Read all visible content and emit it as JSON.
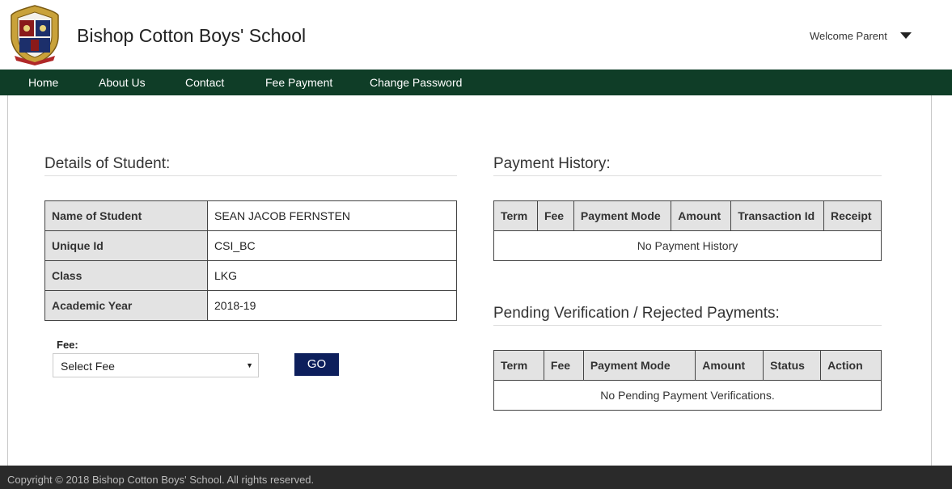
{
  "header": {
    "school_name": "Bishop Cotton Boys' School",
    "welcome": "Welcome Parent"
  },
  "nav": {
    "items": [
      "Home",
      "About Us",
      "Contact",
      "Fee Payment",
      "Change Password"
    ]
  },
  "student": {
    "title": "Details of Student:",
    "rows": [
      {
        "label": "Name of Student",
        "value": "SEAN JACOB FERNSTEN"
      },
      {
        "label": "Unique Id",
        "value": "CSI_BC"
      },
      {
        "label": "Class",
        "value": "LKG"
      },
      {
        "label": "Academic Year",
        "value": "2018-19"
      }
    ]
  },
  "fee_form": {
    "label": "Fee:",
    "selected": "Select Fee",
    "go_label": "GO"
  },
  "payment_history": {
    "title": "Payment History:",
    "columns": [
      "Term",
      "Fee",
      "Payment Mode",
      "Amount",
      "Transaction Id",
      "Receipt"
    ],
    "empty_message": "No Payment History"
  },
  "pending": {
    "title": "Pending Verification / Rejected Payments:",
    "columns": [
      "Term",
      "Fee",
      "Payment Mode",
      "Amount",
      "Status",
      "Action"
    ],
    "empty_message": "No Pending Payment Verifications."
  },
  "footer": {
    "copyright": "Copyright © 2018 Bishop Cotton Boys' School. All rights reserved."
  },
  "colors": {
    "nav_bg": "#0f3d27",
    "go_button_bg": "#0d1f5c",
    "footer_bg": "#2a2a2a"
  },
  "icons": [
    "school-crest-logo",
    "chevron-down-icon",
    "select-arrow-icon"
  ]
}
